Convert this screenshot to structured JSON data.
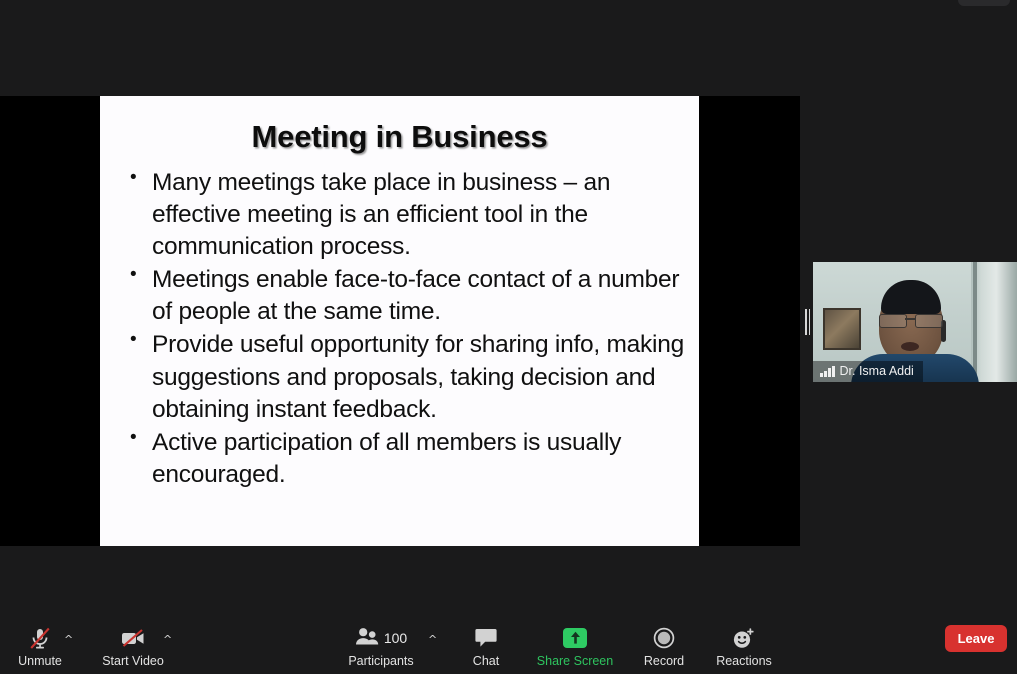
{
  "app": {
    "name": "Zoom Meeting",
    "background_color": "#1a1a1b",
    "share_backdrop_color": "#000000"
  },
  "shared_screen": {
    "type": "presentation-slide",
    "slide": {
      "title": "Meeting in Business",
      "bullets": [
        "Many meetings take place in business – an effective meeting is an efficient tool in the communication process.",
        "Meetings enable face-to-face contact of a number of people at the same time.",
        "Provide useful opportunity for sharing info, making suggestions and proposals, taking decision and obtaining instant feedback.",
        "Active participation of all members is usually encouraged."
      ],
      "background_color": "#fdfcfe",
      "text_color": "#101010"
    }
  },
  "video_thumbnail": {
    "participant_name": "Dr. Isma Addi",
    "signal_icon": "signal-strength-icon",
    "drag_handle_icon": "drag-handle-icon"
  },
  "toolbar": {
    "mute": {
      "label": "Unmute",
      "icon": "microphone-muted-icon",
      "caret_icon": "chevron-up-icon"
    },
    "video": {
      "label": "Start Video",
      "icon": "camera-muted-icon",
      "caret_icon": "chevron-up-icon"
    },
    "participants": {
      "label": "Participants",
      "count": "100",
      "icon": "participants-icon",
      "caret_icon": "chevron-up-icon"
    },
    "chat": {
      "label": "Chat",
      "icon": "chat-bubble-icon"
    },
    "share": {
      "label": "Share Screen",
      "icon": "share-screen-arrow-icon",
      "accent_color": "#2ecb63"
    },
    "record": {
      "label": "Record",
      "icon": "record-circle-icon"
    },
    "reactions": {
      "label": "Reactions",
      "icon": "reactions-smiley-plus-icon"
    },
    "leave": {
      "label": "Leave",
      "accent_color": "#d8322f"
    }
  }
}
